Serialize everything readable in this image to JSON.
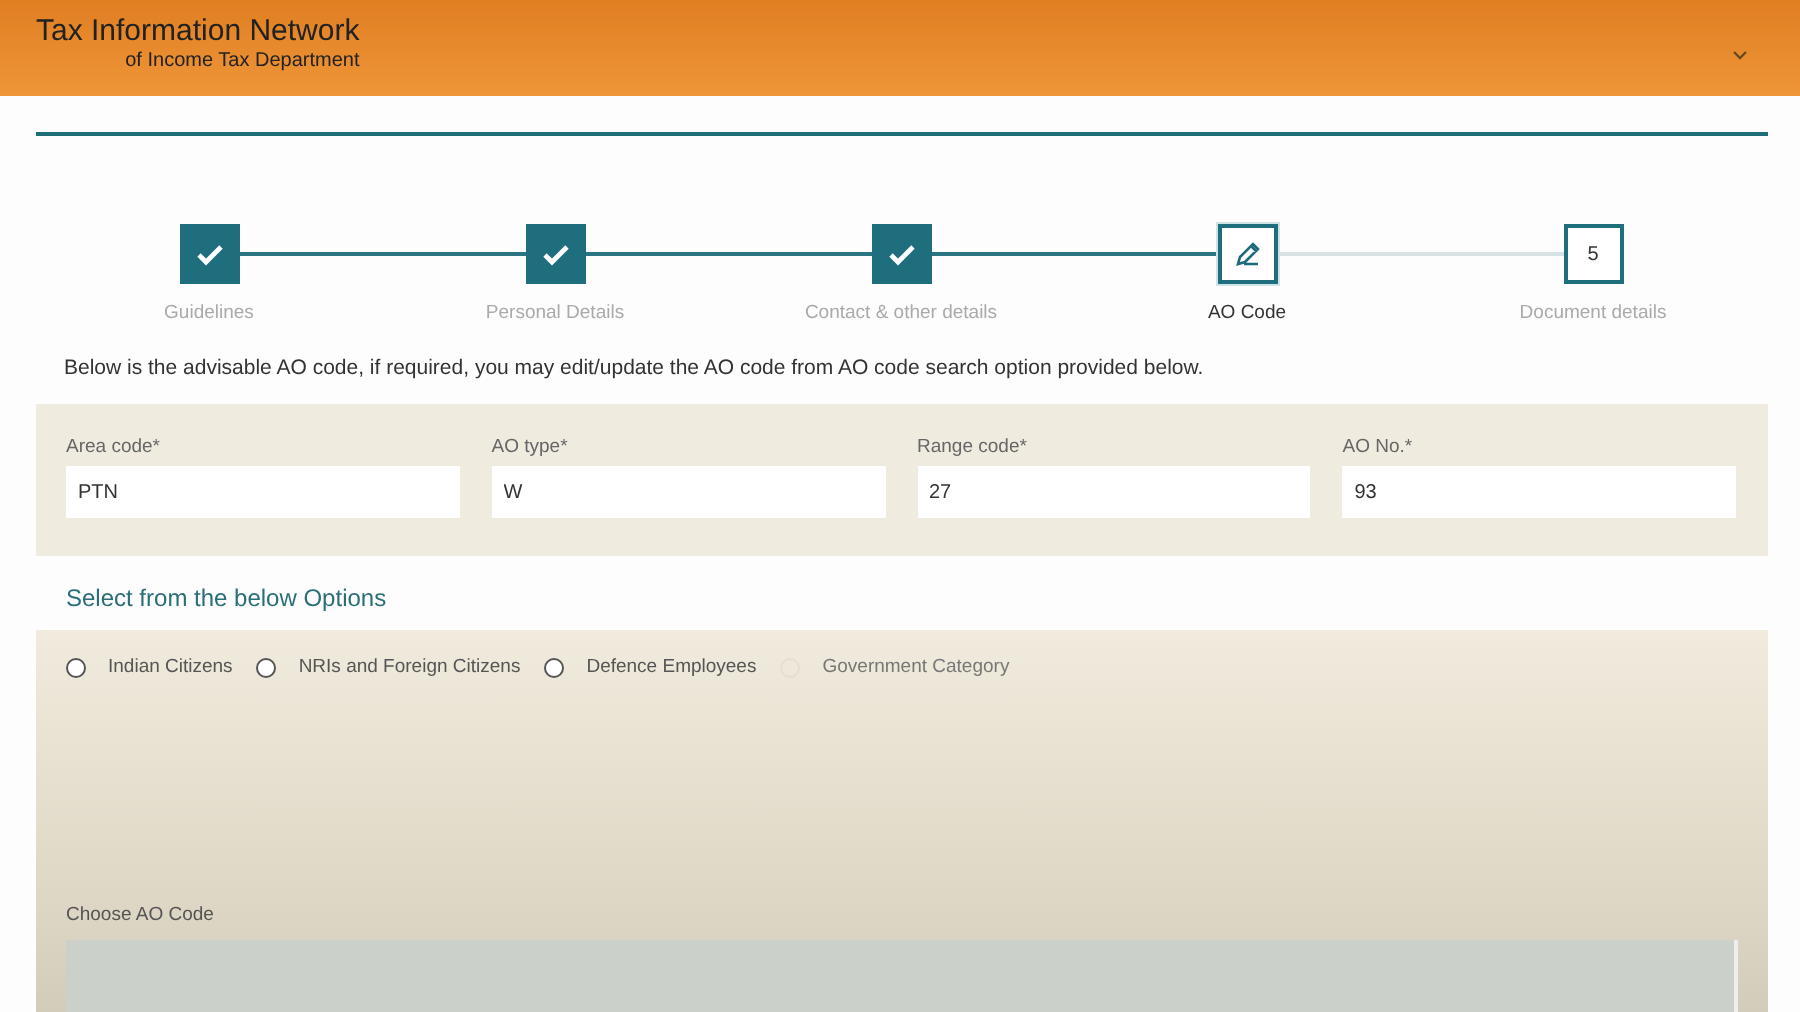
{
  "header": {
    "title": "Tax Information Network",
    "subtitle": "of Income Tax Department"
  },
  "steps": [
    {
      "label": "Guidelines",
      "kind": "done",
      "selected": false
    },
    {
      "label": "Personal Details",
      "kind": "done",
      "selected": false
    },
    {
      "label": "Contact & other details",
      "kind": "done",
      "selected": false
    },
    {
      "label": "AO Code",
      "kind": "current",
      "selected": true
    },
    {
      "label": "Document details",
      "kind": "pending",
      "number": "5",
      "selected": false
    }
  ],
  "intro": "Below is the advisable AO code, if required, you may edit/update the AO code from AO code search option provided below.",
  "fields": [
    {
      "label": "Area code*",
      "value": "PTN"
    },
    {
      "label": "AO type*",
      "value": "W"
    },
    {
      "label": "Range code*",
      "value": "27"
    },
    {
      "label": "AO No.*",
      "value": "93"
    }
  ],
  "options_heading": "Select from the below Options",
  "options": [
    {
      "label": "Indian Citizens",
      "selected": false,
      "disabled": false
    },
    {
      "label": "NRIs and Foreign Citizens",
      "selected": false,
      "disabled": false
    },
    {
      "label": "Defence Employees",
      "selected": false,
      "disabled": false
    },
    {
      "label": "Government Category",
      "selected": false,
      "disabled": true
    }
  ],
  "choose_label": "Choose AO Code"
}
